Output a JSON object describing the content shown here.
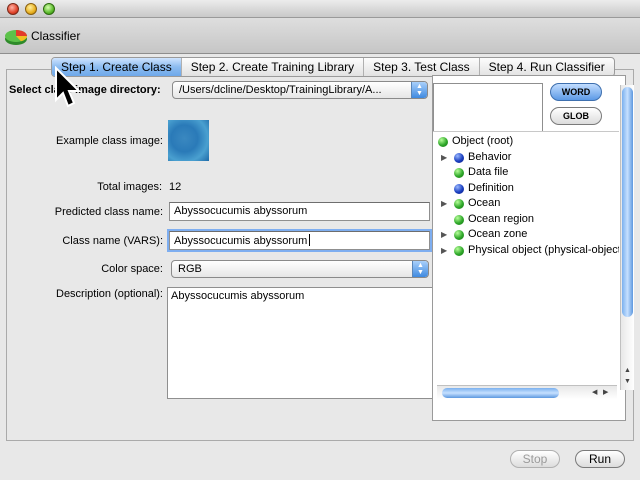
{
  "window": {
    "title_bar_text": ""
  },
  "toolbar": {
    "app_title": "Classifier",
    "app_icon": "pie-chart-icon"
  },
  "tabs": [
    {
      "label": "Step 1. Create Class",
      "active": true
    },
    {
      "label": "Step 2. Create Training Library",
      "active": false
    },
    {
      "label": "Step 3. Test Class",
      "active": false
    },
    {
      "label": "Step 4. Run Classifier",
      "active": false
    }
  ],
  "form": {
    "directory_label": "Select class image directory:",
    "directory_value": "/Users/dcline/Desktop/TrainingLibrary/A...",
    "example_label": "Example class image:",
    "total_images_label": "Total images:",
    "total_images_value": "12",
    "predicted_label": "Predicted class name:",
    "predicted_value": "Abyssocucumis abyssorum",
    "classname_label": "Class name (VARS):",
    "classname_value": "Abyssocucumis abyssorum",
    "colorspace_label": "Color space:",
    "colorspace_value": "RGB",
    "description_label": "Description (optional):",
    "description_value": "Abyssocucumis abyssorum"
  },
  "search": {
    "word_label": "WORD",
    "glob_label": "GLOB",
    "query": ""
  },
  "tree": [
    {
      "label": "Object (root)",
      "dot": "green",
      "expandable": false,
      "indent": 0
    },
    {
      "label": "Behavior",
      "dot": "blue",
      "expandable": true,
      "indent": 1
    },
    {
      "label": "Data file",
      "dot": "green",
      "expandable": false,
      "indent": 1
    },
    {
      "label": "Definition",
      "dot": "blue",
      "expandable": false,
      "indent": 1
    },
    {
      "label": "Ocean",
      "dot": "green",
      "expandable": true,
      "indent": 1
    },
    {
      "label": "Ocean region",
      "dot": "green",
      "expandable": false,
      "indent": 1
    },
    {
      "label": "Ocean zone",
      "dot": "green",
      "expandable": true,
      "indent": 1
    },
    {
      "label": "Physical object (physical-object",
      "dot": "green",
      "expandable": true,
      "indent": 1
    }
  ],
  "buttons": {
    "stop_label": "Stop",
    "run_label": "Run"
  },
  "colors": {
    "accent": "#6ea8ea",
    "focus_ring": "#7eaef0",
    "green_node": "#2fa82a",
    "blue_node": "#1a3fc0"
  }
}
